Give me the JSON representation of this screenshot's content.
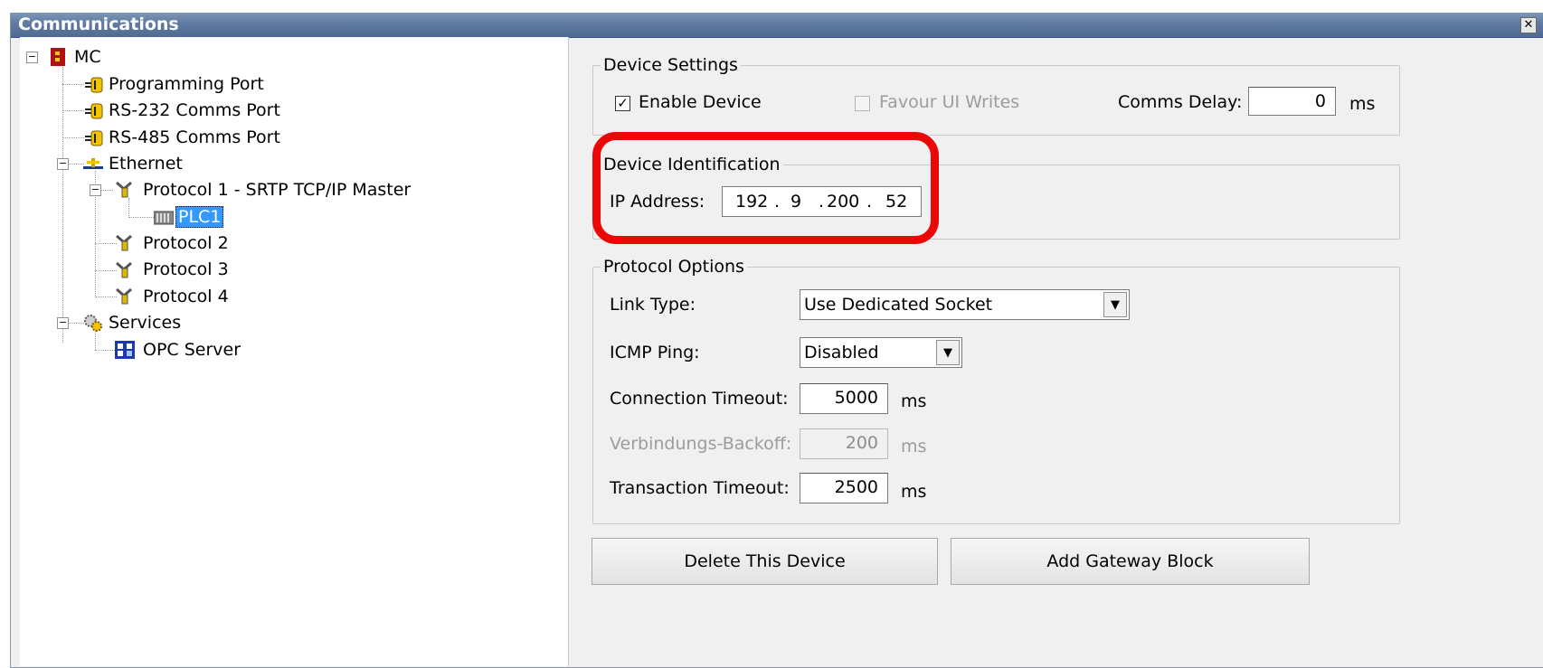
{
  "window": {
    "title": "Communications",
    "close_glyph": "✕"
  },
  "tree": {
    "root": {
      "label": "MC",
      "icon": "controller-icon"
    },
    "programming_port": {
      "label": "Programming Port",
      "icon": "port-icon"
    },
    "rs232": {
      "label": "RS-232 Comms Port",
      "icon": "port-icon"
    },
    "rs485": {
      "label": "RS-485 Comms Port",
      "icon": "port-icon"
    },
    "ethernet": {
      "label": "Ethernet",
      "icon": "network-icon"
    },
    "protocol1": {
      "label": "Protocol 1 - SRTP TCP/IP Master",
      "icon": "protocol-icon"
    },
    "plc1": {
      "label": "PLC1",
      "icon": "plc-icon",
      "selected": true
    },
    "protocol2": {
      "label": "Protocol 2",
      "icon": "protocol-icon"
    },
    "protocol3": {
      "label": "Protocol 3",
      "icon": "protocol-icon"
    },
    "protocol4": {
      "label": "Protocol 4",
      "icon": "protocol-icon"
    },
    "services": {
      "label": "Services",
      "icon": "gears-icon"
    },
    "opc_server": {
      "label": "OPC Server",
      "icon": "opc-icon"
    }
  },
  "device_settings": {
    "legend": "Device Settings",
    "enable_device": {
      "label": "Enable Device",
      "checked": true
    },
    "favour_ui_writes": {
      "label": "Favour UI Writes",
      "checked": false,
      "enabled": false
    },
    "comms_delay": {
      "label": "Comms Delay:",
      "value": "0",
      "unit": "ms"
    }
  },
  "device_identification": {
    "legend": "Device Identification",
    "ip_label": "IP Address:",
    "ip": [
      "192",
      "9",
      "200",
      "52"
    ],
    "dot": "."
  },
  "protocol_options": {
    "legend": "Protocol Options",
    "link_type": {
      "label": "Link Type:",
      "value": "Use Dedicated Socket"
    },
    "icmp_ping": {
      "label": "ICMP Ping:",
      "value": "Disabled"
    },
    "connection_timeout": {
      "label": "Connection Timeout:",
      "value": "5000",
      "unit": "ms"
    },
    "backoff": {
      "label": "Verbindungs-Backoff:",
      "value": "200",
      "unit": "ms",
      "enabled": false
    },
    "transaction_timeout": {
      "label": "Transaction Timeout:",
      "value": "2500",
      "unit": "ms"
    }
  },
  "buttons": {
    "delete": "Delete This Device",
    "add_gateway": "Add Gateway Block"
  },
  "glyphs": {
    "check": "✓",
    "expand_minus": "−",
    "dropdown_arrow": "▼"
  },
  "colors": {
    "highlight": "#ec0707",
    "selection": "#3399ff",
    "titlebar": "#5e7aa0"
  }
}
